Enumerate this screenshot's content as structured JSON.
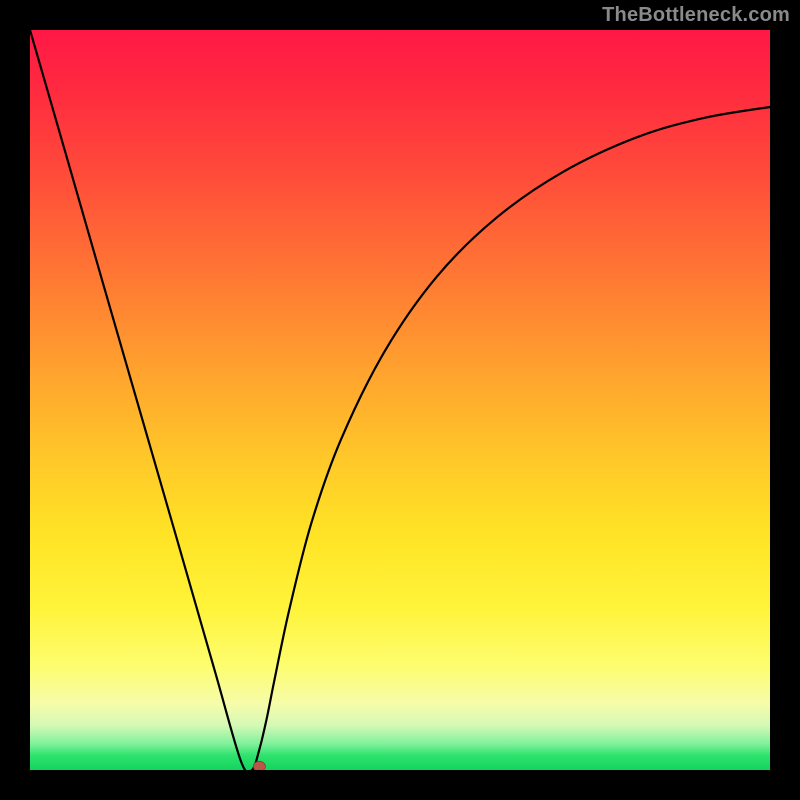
{
  "watermark": "TheBottleneck.com",
  "chart_data": {
    "type": "line",
    "title": "",
    "xlabel": "",
    "ylabel": "",
    "x": [
      0.0,
      0.05,
      0.1,
      0.15,
      0.2,
      0.25,
      0.285,
      0.3,
      0.31,
      0.32,
      0.33,
      0.35,
      0.38,
      0.42,
      0.48,
      0.55,
      0.63,
      0.72,
      0.82,
      0.91,
      1.0
    ],
    "values": [
      100.0,
      82.7,
      65.3,
      48.0,
      30.7,
      13.3,
      1.2,
      0.0,
      2.8,
      7.0,
      12.0,
      21.5,
      33.3,
      44.6,
      56.7,
      66.7,
      74.6,
      80.8,
      85.5,
      88.1,
      89.6
    ],
    "xlim": [
      0,
      1
    ],
    "ylim": [
      0,
      100
    ],
    "minimum_point": {
      "x": 0.3,
      "y": 0.0
    },
    "marker": {
      "x": 0.31,
      "y": 0.5,
      "color": "#b9564a"
    },
    "background": {
      "type": "vertical-gradient",
      "top_color": "#ff1846",
      "bottom_color": "#12d45e"
    },
    "grid": false,
    "legend": false
  }
}
